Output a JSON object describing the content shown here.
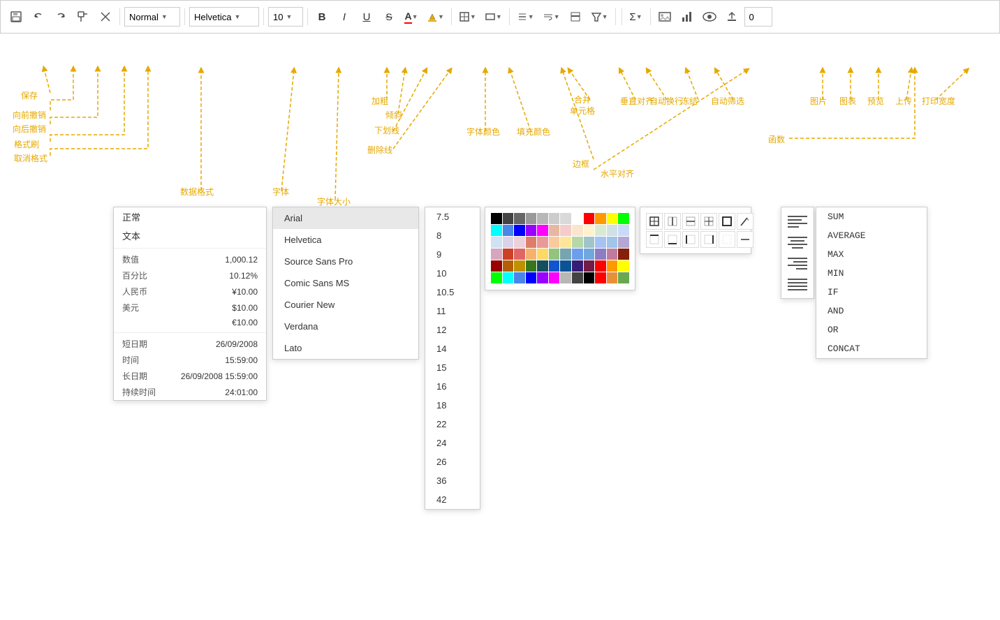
{
  "toolbar": {
    "format_label": "Normal",
    "font_label": "Helvetica",
    "font_size_label": "10",
    "print_width_value": "0",
    "buttons": {
      "save": "💾",
      "undo": "↩",
      "redo": "↪",
      "format_painter": "🖌",
      "clear_format": "✕",
      "bold": "B",
      "italic": "I",
      "underline": "U",
      "strikethrough": "S",
      "font_color": "A",
      "fill_color": "🪣",
      "border": "⊞",
      "merge": "⊟",
      "align_vertical": "≡",
      "align_auto": "↕",
      "freeze": "❄",
      "filter": "▽",
      "sum": "Σ",
      "image": "🖼",
      "chart": "📊",
      "preview": "👁",
      "upload": "⬆",
      "print_width": "0"
    }
  },
  "annotations": {
    "save": "保存",
    "undo": "向前撤销",
    "redo": "向后撤销",
    "format_painter": "格式刷",
    "clear_format": "取消格式",
    "data_format": "数据格式",
    "font": "字体",
    "font_size": "字体大小",
    "bold": "加粗",
    "italic": "倾斜",
    "underline": "下划线",
    "strikethrough": "删除线",
    "font_color": "字体颜色",
    "fill_color": "填充颜色",
    "merge": "合并\n单元格",
    "align_vertical": "垂直对齐",
    "align_auto": "自动换行",
    "freeze": "冻结",
    "filter": "自动筛选",
    "align_horizontal": "水平对齐",
    "border": "边框",
    "image": "图片",
    "chart": "图表",
    "preview": "预览",
    "upload": "上传",
    "print_width": "打印宽度",
    "function": "函数"
  },
  "format_panel": {
    "normal": "正常",
    "text": "文本",
    "items": [
      {
        "label": "数值",
        "value": "1,000.12"
      },
      {
        "label": "百分比",
        "value": "10.12%"
      },
      {
        "label": "人民币",
        "value": "¥10.00"
      },
      {
        "label": "美元",
        "value": "$10.00"
      },
      {
        "label": "",
        "value": "€10.00"
      },
      {
        "label": "短日期",
        "value": "26/09/2008"
      },
      {
        "label": "时间",
        "value": "15:59:00"
      },
      {
        "label": "长日期",
        "value": "26/09/2008 15:59:00"
      },
      {
        "label": "持续时间",
        "value": "24:01:00"
      }
    ]
  },
  "font_panel": {
    "items": [
      {
        "label": "Arial",
        "selected": true
      },
      {
        "label": "Helvetica"
      },
      {
        "label": "Source Sans Pro"
      },
      {
        "label": "Comic Sans MS"
      },
      {
        "label": "Courier New"
      },
      {
        "label": "Verdana"
      },
      {
        "label": "Lato"
      }
    ]
  },
  "fontsize_panel": {
    "sizes": [
      "7.5",
      "8",
      "9",
      "10",
      "10.5",
      "11",
      "12",
      "14",
      "15",
      "16",
      "18",
      "22",
      "24",
      "26",
      "36",
      "42"
    ]
  },
  "color_panel": {
    "rows": [
      [
        "#000000",
        "#434343",
        "#666666",
        "#999999",
        "#b7b7b7",
        "#cccccc",
        "#d9d9d9",
        "#ffffff",
        "#ff0000",
        "#ff9900",
        "#ffff00",
        "#00ff00"
      ],
      [
        "#00ffff",
        "#4a86e8",
        "#0000ff",
        "#9900ff",
        "#ff00ff",
        "#e6b8a2",
        "#f4cccc",
        "#fce5cd",
        "#fff2cc",
        "#d9ead3",
        "#d0e0e3",
        "#c9daf8"
      ],
      [
        "#cfe2f3",
        "#d9d2e9",
        "#ead1dc",
        "#dd7e6b",
        "#ea9999",
        "#f9cb9c",
        "#ffe599",
        "#b6d7a8",
        "#a2c4c9",
        "#a4c2f4",
        "#9fc5e8",
        "#b4a7d6"
      ],
      [
        "#d5a6bd",
        "#cc4125",
        "#e06666",
        "#f6b26b",
        "#ffd966",
        "#93c47d",
        "#76a5af",
        "#6d9eeb",
        "#6fa8dc",
        "#8e7cc3",
        "#c27ba0",
        "#85200c"
      ],
      [
        "#990000",
        "#b45f06",
        "#bf9000",
        "#38761d",
        "#134f5c",
        "#1155cc",
        "#0b5394",
        "#351c75",
        "#741b47",
        "#ff0000",
        "#ff9900",
        "#ffff00"
      ],
      [
        "#00ff00",
        "#00ffff",
        "#4a86e8",
        "#0000ff",
        "#9900ff",
        "#ff00ff",
        "#b7b7b7",
        "#434343",
        "#000000",
        "#ff0000",
        "#e69138",
        "#6aa84f"
      ]
    ]
  },
  "border_panel": {
    "buttons": [
      "⊞",
      "⊟",
      "⊡",
      "⊠",
      "⬜",
      "╱",
      "─",
      "│",
      "┼",
      "╔",
      "╗",
      "╝"
    ]
  },
  "align_panel": {
    "options": [
      "left",
      "center",
      "right",
      "justify"
    ]
  },
  "func_panel": {
    "items": [
      "SUM",
      "AVERAGE",
      "MAX",
      "MIN",
      "IF",
      "AND",
      "OR",
      "CONCAT"
    ]
  }
}
